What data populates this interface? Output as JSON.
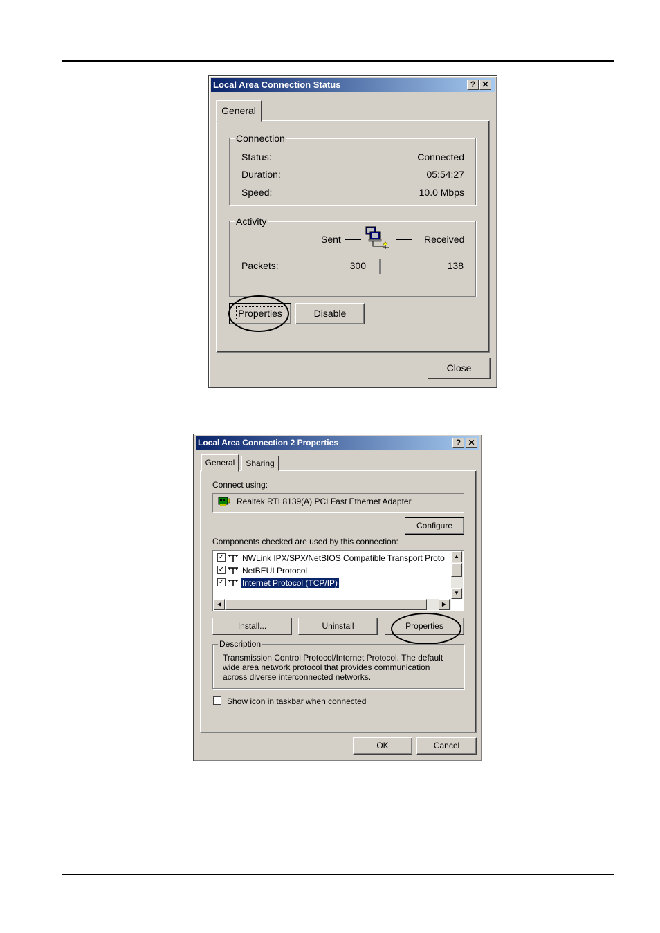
{
  "dialog1": {
    "title": "Local Area Connection Status",
    "help_label": "?",
    "close_x_label": "✕",
    "tab_general": "General",
    "connection_group": "Connection",
    "status_label": "Status:",
    "status_value": "Connected",
    "duration_label": "Duration:",
    "duration_value": "05:54:27",
    "speed_label": "Speed:",
    "speed_value": "10.0 Mbps",
    "activity_group": "Activity",
    "sent_label": "Sent",
    "received_label": "Received",
    "packets_label": "Packets:",
    "packets_sent": "300",
    "packets_received": "138",
    "properties_button": "Properties",
    "disable_button": "Disable",
    "close_button": "Close"
  },
  "dialog2": {
    "title": "Local Area Connection 2 Properties",
    "help_label": "?",
    "close_x_label": "✕",
    "tab_general": "General",
    "tab_sharing": "Sharing",
    "connect_using_label": "Connect using:",
    "adapter_name": "Realtek RTL8139(A) PCI Fast Ethernet Adapter",
    "configure_button": "Configure",
    "components_label": "Components checked are used by this connection:",
    "components": [
      {
        "label": "NWLink IPX/SPX/NetBIOS Compatible Transport Proto",
        "checked": true
      },
      {
        "label": "NetBEUI Protocol",
        "checked": true
      },
      {
        "label": "Internet Protocol (TCP/IP)",
        "checked": true
      }
    ],
    "install_button": "Install...",
    "uninstall_button": "Uninstall",
    "properties_button": "Properties",
    "description_group": "Description",
    "description_lines": [
      "Transmission Control Protocol/Internet Protocol. The default",
      "wide area network protocol that provides communication",
      "across diverse interconnected networks."
    ],
    "show_icon_label": "Show icon in taskbar when connected",
    "show_icon_checked": false,
    "ok_button": "OK",
    "cancel_button": "Cancel"
  }
}
